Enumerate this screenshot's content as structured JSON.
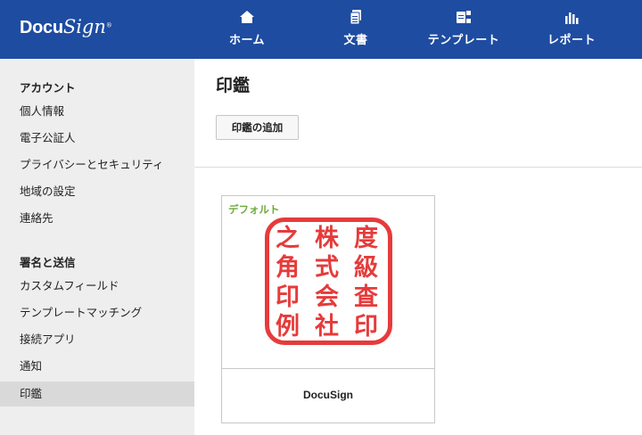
{
  "header": {
    "logo_docu": "Docu",
    "logo_sign": "Sign",
    "logo_mark": "®",
    "nav": [
      {
        "label": "ホーム",
        "icon": "home-icon"
      },
      {
        "label": "文書",
        "icon": "documents-icon"
      },
      {
        "label": "テンプレート",
        "icon": "templates-icon"
      },
      {
        "label": "レポート",
        "icon": "reports-icon"
      }
    ]
  },
  "sidebar": {
    "sections": [
      {
        "title": "アカウント",
        "items": [
          "個人情報",
          "電子公証人",
          "プライバシーとセキュリティ",
          "地域の設定",
          "連絡先"
        ]
      },
      {
        "title": "署名と送信",
        "items": [
          "カスタムフィールド",
          "テンプレートマッチング",
          "接続アプリ",
          "通知",
          "印鑑"
        ]
      }
    ],
    "active_item": "印鑑"
  },
  "main": {
    "title": "印鑑",
    "add_button": "印鑑の追加",
    "seal_card": {
      "badge": "デフォルト",
      "stamp_text": [
        "之",
        "角",
        "印",
        "例",
        "株",
        "式",
        "会",
        "社",
        "度",
        "級",
        "査",
        "印"
      ],
      "name": "DocuSign"
    }
  },
  "colors": {
    "header_bg": "#1e4ca1",
    "sidebar_bg": "#eeeeee",
    "active_item_bg": "#d9d9d9",
    "default_badge": "#6cab3a",
    "stamp_red": "#e63b3b"
  }
}
